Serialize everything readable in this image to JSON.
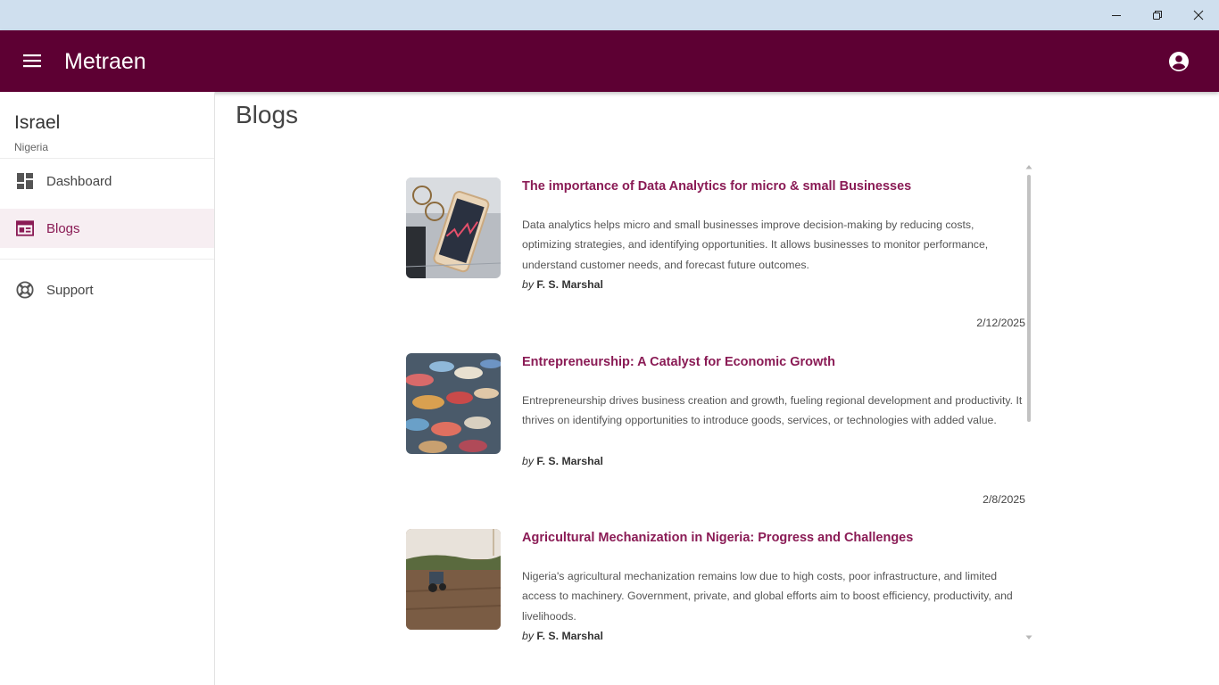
{
  "window": {
    "minimize_icon": "minimize-icon",
    "restore_icon": "restore-icon",
    "close_icon": "close-icon"
  },
  "appbar": {
    "title": "Metraen",
    "menu_icon": "hamburger-menu-icon",
    "account_icon": "account-circle-icon",
    "background": "#5d0033"
  },
  "sidebar": {
    "user_name": "Israel",
    "user_location": "Nigeria",
    "items": [
      {
        "label": "Dashboard",
        "icon": "dashboard-icon",
        "active": false
      },
      {
        "label": "Blogs",
        "icon": "blogs-icon",
        "active": true
      },
      {
        "label": "Support",
        "icon": "support-icon",
        "active": false
      }
    ]
  },
  "main": {
    "page_title": "Blogs",
    "posts": [
      {
        "title": "The importance of Data Analytics for micro & small Businesses",
        "excerpt": "Data analytics helps micro and small businesses improve decision-making by reducing costs, optimizing strategies, and identifying opportunities. It allows businesses to monitor performance, understand customer needs, and forecast future outcomes.",
        "by": "by",
        "author": "F. S. Marshal",
        "date": "2/12/2025"
      },
      {
        "title": "Entrepreneurship: A Catalyst for Economic Growth",
        "excerpt": "Entrepreneurship drives business creation and growth, fueling regional development and productivity. It thrives on identifying opportunities to introduce goods, services, or technologies with added value.",
        "by": "by",
        "author": "F. S. Marshal",
        "date": "2/8/2025"
      },
      {
        "title": "Agricultural Mechanization in Nigeria: Progress and Challenges",
        "excerpt": "Nigeria's agricultural mechanization remains low due to high costs, poor infrastructure, and limited access to machinery. Government, private, and global efforts aim to boost efficiency, productivity, and livelihoods.",
        "by": "by",
        "author": "F. S. Marshal",
        "date": ""
      }
    ]
  },
  "colors": {
    "accent": "#8a1b55",
    "active_nav_bg": "#f7eef2",
    "titlebar": "#cfdfee"
  }
}
